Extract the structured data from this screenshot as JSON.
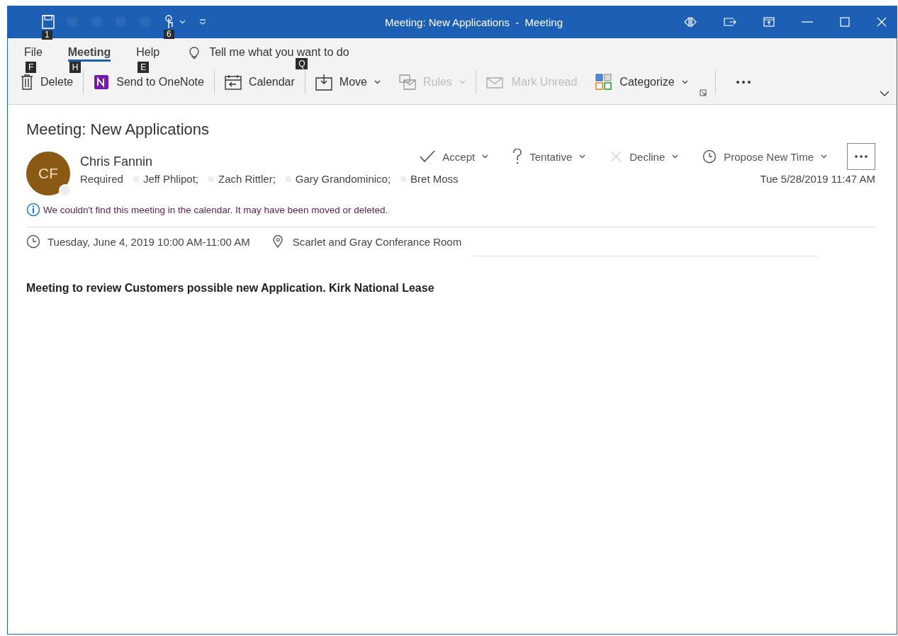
{
  "window": {
    "title": "Meeting: New Applications  -  Meeting"
  },
  "quick_access": [
    {
      "kind": "save",
      "keytip": "1"
    },
    {
      "kind": "touch",
      "keytip": "6"
    }
  ],
  "ribbon_tabs": [
    {
      "label": "File",
      "keytip": "F",
      "selected": false
    },
    {
      "label": "Meeting",
      "keytip": "H",
      "selected": true
    },
    {
      "label": "Help",
      "keytip": "E",
      "selected": false
    }
  ],
  "tell_me": {
    "placeholder": "Tell me what you want to do",
    "keytip": "Q"
  },
  "commands": [
    {
      "kind": "delete",
      "label": "Delete",
      "disabled": false,
      "dropdown": false
    },
    {
      "kind": "onenote",
      "label": "Send to OneNote",
      "disabled": false,
      "dropdown": false
    },
    {
      "kind": "calendar",
      "label": "Calendar",
      "disabled": false,
      "dropdown": false
    },
    {
      "kind": "move",
      "label": "Move",
      "disabled": false,
      "dropdown": true
    },
    {
      "kind": "rules",
      "label": "Rules",
      "disabled": true,
      "dropdown": true
    },
    {
      "kind": "mark_unread",
      "label": "Mark Unread",
      "disabled": true,
      "dropdown": false
    },
    {
      "kind": "categorize",
      "label": "Categorize",
      "disabled": false,
      "dropdown": true
    }
  ],
  "message": {
    "subject": "Meeting: New Applications",
    "sender": {
      "name": "Chris Fannin",
      "initials": "CF"
    },
    "required_label": "Required",
    "attendees": [
      "Jeff Phlipot;",
      "Zach Rittler;",
      "Gary Grandominico;",
      "Bret Moss"
    ],
    "sent": "Tue 5/28/2019 11:47 AM",
    "responses": [
      {
        "kind": "accept",
        "label": "Accept"
      },
      {
        "kind": "tentative",
        "label": "Tentative"
      },
      {
        "kind": "decline",
        "label": "Decline"
      },
      {
        "kind": "propose",
        "label": "Propose New Time"
      }
    ],
    "info": "We couldn't find this meeting in the calendar. It may have been moved or deleted.",
    "when": "Tuesday, June 4, 2019 10:00 AM-11:00 AM",
    "location": "Scarlet and Gray Conferance Room",
    "body": "Meeting to review Customers possible new Application. Kirk National Lease"
  }
}
